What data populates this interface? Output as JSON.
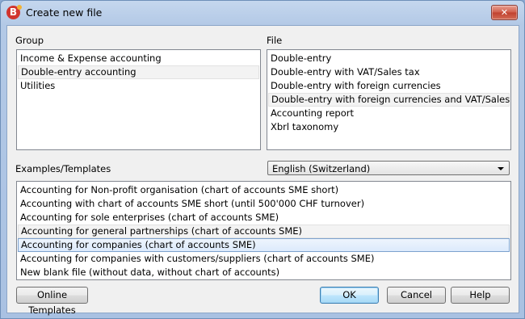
{
  "window": {
    "title": "Create new file",
    "close_glyph": "✕",
    "app_icon": "banana-app-icon"
  },
  "group": {
    "label": "Group",
    "items": [
      "Income & Expense accounting",
      "Double-entry accounting",
      "Utilities"
    ],
    "selected_index": 1
  },
  "file": {
    "label": "File",
    "items": [
      "Double-entry",
      "Double-entry with VAT/Sales tax",
      "Double-entry with foreign currencies",
      "Double-entry with foreign currencies and VAT/Sales tax",
      "Accounting report",
      "Xbrl taxonomy"
    ],
    "selected_index": 3
  },
  "templates": {
    "label": "Examples/Templates",
    "language": "English (Switzerland)",
    "items": [
      "Accounting for Non-profit organisation (chart of accounts SME short)",
      "Accounting with chart of accounts SME short (until 500'000 CHF turnover)",
      "Accounting for sole enterprises (chart of accounts SME)",
      "Accounting for general partnerships (chart of accounts SME)",
      "Accounting for companies (chart of accounts SME)",
      "Accounting for companies with customers/suppliers (chart of accounts SME)",
      "New blank file (without data, without chart of accounts)"
    ],
    "hover_index": 3,
    "selected_index": 4
  },
  "buttons": {
    "online_templates": "Online Templates",
    "ok": "OK",
    "cancel": "Cancel",
    "help": "Help"
  }
}
